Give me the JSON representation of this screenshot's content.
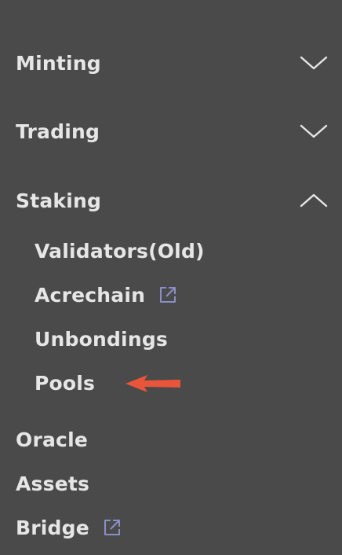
{
  "menu": {
    "minting": {
      "label": "Minting",
      "chevron": "chevron-down-icon"
    },
    "trading": {
      "label": "Trading",
      "chevron": "chevron-down-icon"
    },
    "staking": {
      "label": "Staking",
      "chevron": "chevron-up-icon",
      "items": [
        {
          "label": "Validators(Old)"
        },
        {
          "label": "Acrechain",
          "icon": "external-link-icon"
        },
        {
          "label": "Unbondings"
        },
        {
          "label": "Pools"
        }
      ]
    },
    "oracle": {
      "label": "Oracle"
    },
    "assets": {
      "label": "Assets"
    },
    "bridge": {
      "label": "Bridge",
      "icon": "external-link-icon"
    }
  },
  "colors": {
    "background": "#4a4a4a",
    "text": "#e6e6e6",
    "chevron": "#e6e6e6",
    "external_icon": "#8b8fc7",
    "annotation_arrow": "#e8553a"
  }
}
